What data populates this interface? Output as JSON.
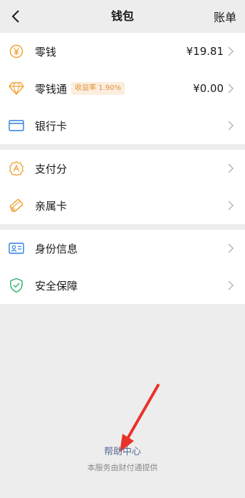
{
  "nav": {
    "title": "钱包",
    "right_label": "账单"
  },
  "groups": [
    {
      "items": [
        {
          "label": "零钱",
          "value": "¥19.81",
          "icon": "yuan-coin-icon"
        },
        {
          "label": "零钱通",
          "badge": "收益率 1.90%",
          "value": "¥0.00",
          "icon": "diamond-icon"
        },
        {
          "label": "银行卡",
          "icon": "bank-card-icon"
        }
      ]
    },
    {
      "items": [
        {
          "label": "支付分",
          "icon": "badge-a-icon"
        },
        {
          "label": "亲属卡",
          "icon": "family-card-icon"
        }
      ]
    },
    {
      "items": [
        {
          "label": "身份信息",
          "icon": "id-card-icon"
        },
        {
          "label": "安全保障",
          "icon": "shield-check-icon"
        }
      ]
    }
  ],
  "footer": {
    "help_link": "帮助中心",
    "provider": "本服务由财付通提供"
  },
  "colors": {
    "background": "#ededed",
    "accent_orange": "#f0a02e",
    "accent_blue": "#2f7fe0",
    "accent_green": "#2aae67",
    "link": "#576b95",
    "annotation_red": "#e8332a"
  }
}
